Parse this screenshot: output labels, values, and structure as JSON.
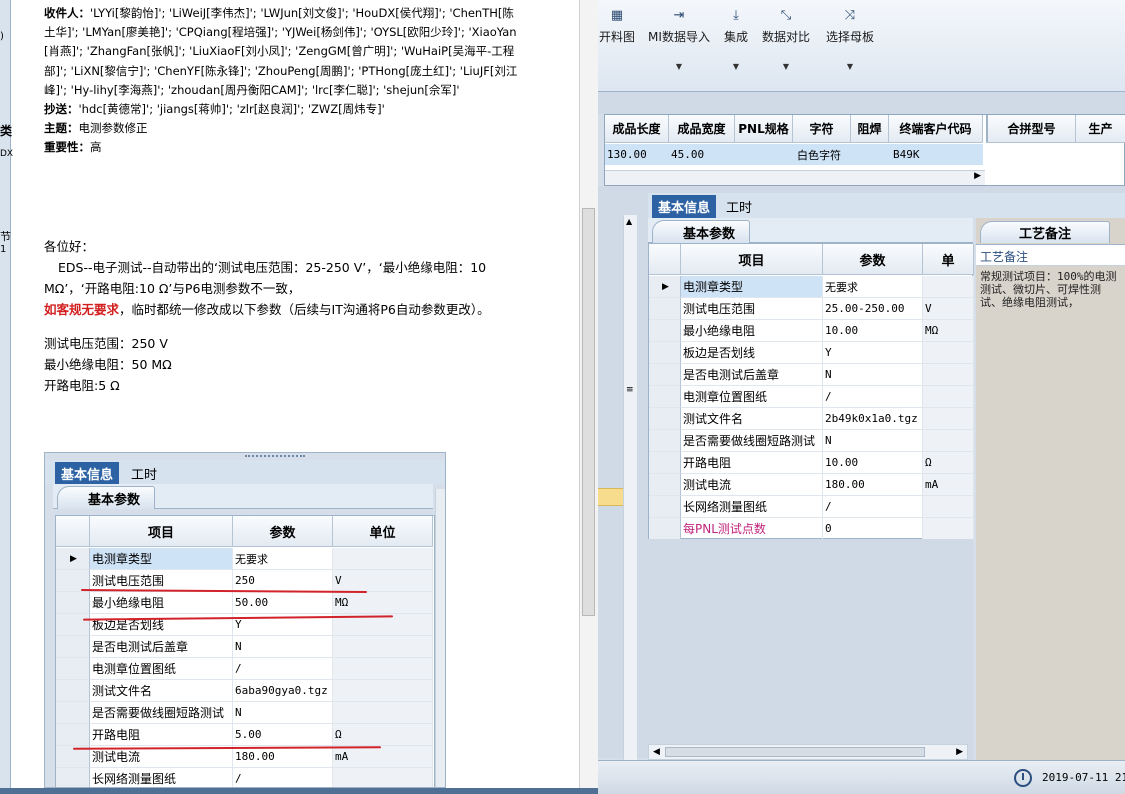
{
  "mail": {
    "recipients_label": "收件人：",
    "recipients": "'LYYi[黎韵怡]'; 'LiWeiJ[李伟杰]'; 'LWJun[刘文俊]'; 'HouDX[侯代翔]'; 'ChenTH[陈土华]'; 'LMYan[廖美艳]'; 'CPQiang[程培强]'; 'YJWei[杨剑伟]'; 'OYSL[欧阳少玲]'; 'XiaoYan[肖燕]'; 'ZhangFan[张帆]'; 'LiuXiaoF[刘小凤]'; 'ZengGM[曾广明]'; 'WuHaiP[吴海平-工程部]'; 'LiXN[黎信宁]'; 'ChenYF[陈永锋]'; 'ZhouPeng[周鹏]'; 'PTHong[庞土红]'; 'LiuJF[刘江峰]'; 'Hy-lihy[李海燕]'; 'zhoudan[周丹衡阳CAM]'; 'lrc[李仁聪]'; 'shejun[佘军]'",
    "cc_label": "抄送：",
    "cc": "'hdc[黄德常]'; 'jiangs[蒋帅]'; 'zlr[赵良润]'; 'ZWZ[周炜专]'",
    "subject_label": "主题：",
    "subject": "电测参数修正",
    "importance_label": "重要性：",
    "importance": "高",
    "greeting": "各位好：",
    "para1": "EDS--电子测试--自动带出的‘测试电压范围：25-250 V’，‘最小绝缘电阻：10 MΩ’，‘开路电阻:10 Ω’与P6电测参数不一致，",
    "para2_red": "如客规无要求",
    "para2_rest": "，临时都统一修改成以下参数（后续与IT沟通将P6自动参数更改）。",
    "line_voltage": "测试电压范围：250 V",
    "line_insulation": "最小绝缘电阻：50 MΩ",
    "line_open": "开路电阻:5 Ω",
    "left_edge_text": [
      ")",
      "类",
      "DX",
      "节",
      "1"
    ]
  },
  "embedded": {
    "tab_basic": "基本信息",
    "tab_hours": "工时",
    "subtab": "基本参数",
    "headers": [
      "项目",
      "参数",
      "单位"
    ],
    "rows": [
      {
        "item": "电测章类型",
        "param": "无要求",
        "unit": ""
      },
      {
        "item": "测试电压范围",
        "param": "250",
        "unit": "V"
      },
      {
        "item": "最小绝缘电阻",
        "param": "50.00",
        "unit": "MΩ"
      },
      {
        "item": "板边是否划线",
        "param": "Y",
        "unit": ""
      },
      {
        "item": "是否电测试后盖章",
        "param": "N",
        "unit": ""
      },
      {
        "item": "电测章位置图纸",
        "param": "/",
        "unit": ""
      },
      {
        "item": "测试文件名",
        "param": "6aba90gya0.tgz",
        "unit": ""
      },
      {
        "item": "是否需要做线圈短路测试",
        "param": "N",
        "unit": ""
      },
      {
        "item": "开路电阻",
        "param": "5.00",
        "unit": "Ω"
      },
      {
        "item": "测试电流",
        "param": "180.00",
        "unit": "mA"
      },
      {
        "item": "长网络测量图纸",
        "param": "/",
        "unit": ""
      }
    ]
  },
  "app": {
    "ribbon": [
      {
        "icon": "▦",
        "label": "开料图",
        "name": "ribbon-cutting-chart"
      },
      {
        "icon": "⇥",
        "label": "MI数据导入",
        "name": "ribbon-mi-import"
      },
      {
        "icon": "⤓",
        "label": "集成",
        "name": "ribbon-integrate"
      },
      {
        "icon": "⤡",
        "label": "数据对比",
        "name": "ribbon-compare"
      },
      {
        "icon": "⤨",
        "label": "选择母板",
        "name": "ribbon-select-mother"
      }
    ],
    "top_headers": [
      "成品长度",
      "成品宽度",
      "PNL规格",
      "字符",
      "阻焊",
      "终端客户代码",
      "合拼型号",
      "生产"
    ],
    "top_row": {
      "length": "130.00",
      "width": "45.00",
      "pnl": "",
      "char": "白色字符",
      "mask": "",
      "client": "B49K"
    },
    "tab_basic": "基本信息",
    "tab_hours": "工时",
    "subtab": "基本参数",
    "headers": [
      "项目",
      "参数",
      "单"
    ],
    "rows": [
      {
        "item": "电测章类型",
        "param": "无要求",
        "unit": "",
        "pink": false
      },
      {
        "item": "测试电压范围",
        "param": "25.00-250.00",
        "unit": "V",
        "pink": false
      },
      {
        "item": "最小绝缘电阻",
        "param": "10.00",
        "unit": "MΩ",
        "pink": false
      },
      {
        "item": "板边是否划线",
        "param": "Y",
        "unit": "",
        "pink": false
      },
      {
        "item": "是否电测试后盖章",
        "param": "N",
        "unit": "",
        "pink": false
      },
      {
        "item": "电测章位置图纸",
        "param": "/",
        "unit": "",
        "pink": false
      },
      {
        "item": "测试文件名",
        "param": "2b49k0x1a0.tgz",
        "unit": "",
        "pink": false
      },
      {
        "item": "是否需要做线圈短路测试",
        "param": "N",
        "unit": "",
        "pink": false
      },
      {
        "item": "开路电阻",
        "param": "10.00",
        "unit": "Ω",
        "pink": false
      },
      {
        "item": "测试电流",
        "param": "180.00",
        "unit": "mA",
        "pink": false
      },
      {
        "item": "长网络测量图纸",
        "param": "/",
        "unit": "",
        "pink": false
      },
      {
        "item": "每PNL测试点数",
        "param": "0",
        "unit": "",
        "pink": true
      }
    ],
    "remark_tab": "工艺备注",
    "remark_head": "工艺备注",
    "remark_body": "常规测试项目：100%的电测测试、微切片、可焊性测试、绝缘电阻测试，",
    "datetime": "2019-07-11 21"
  },
  "colors": {
    "accent": "#2c62a3",
    "red_mark": "#d2232a",
    "selection": "#cfe3f7",
    "pink_text": "#c0247c"
  }
}
